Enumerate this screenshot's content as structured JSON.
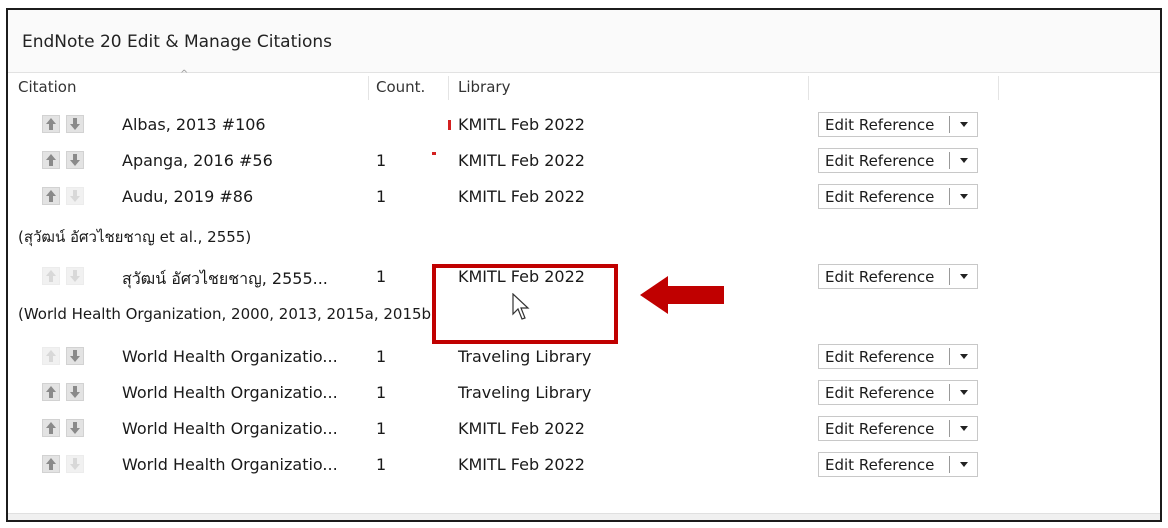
{
  "window": {
    "title": "EndNote 20 Edit & Manage Citations"
  },
  "columns": {
    "citation": "Citation",
    "count": "Count.",
    "library": "Library"
  },
  "edit_button_label": "Edit Reference",
  "groups": {
    "g2": "(สุวัฒน์ อัศวไชยชาญ et al., 2555)",
    "g3": "(World Health Organization, 2000, 2013, 2015a, 2015b)"
  },
  "rows": [
    {
      "citation": "Albas, 2013 #106",
      "count": "",
      "library": "KMITL Feb 2022"
    },
    {
      "citation": "Apanga, 2016 #56",
      "count": "1",
      "library": "KMITL Feb 2022"
    },
    {
      "citation": "Audu, 2019 #86",
      "count": "1",
      "library": "KMITL Feb 2022"
    },
    {
      "citation": "สุวัฒน์ อัศวไชยชาญ, 2555...",
      "count": "1",
      "library": "KMITL Feb 2022"
    },
    {
      "citation": "World Health Organizatio...",
      "count": "1",
      "library": "Traveling Library"
    },
    {
      "citation": "World Health Organizatio...",
      "count": "1",
      "library": "Traveling Library"
    },
    {
      "citation": "World Health Organizatio...",
      "count": "1",
      "library": "KMITL Feb 2022"
    },
    {
      "citation": "World Health Organizatio...",
      "count": "1",
      "library": "KMITL Feb 2022"
    }
  ],
  "icons": {
    "move_up": "up-arrow-icon",
    "move_down": "down-arrow-icon",
    "dropdown": "triangle-down-icon",
    "pointer": "mouse-cursor-icon",
    "annotation_arrow": "left-arrow-icon"
  },
  "colors": {
    "annotation": "#c00000",
    "button_bg": "#e3e3e3",
    "arrow_dark": "#8a8a8a",
    "arrow_faded": "#d8d8d8"
  }
}
